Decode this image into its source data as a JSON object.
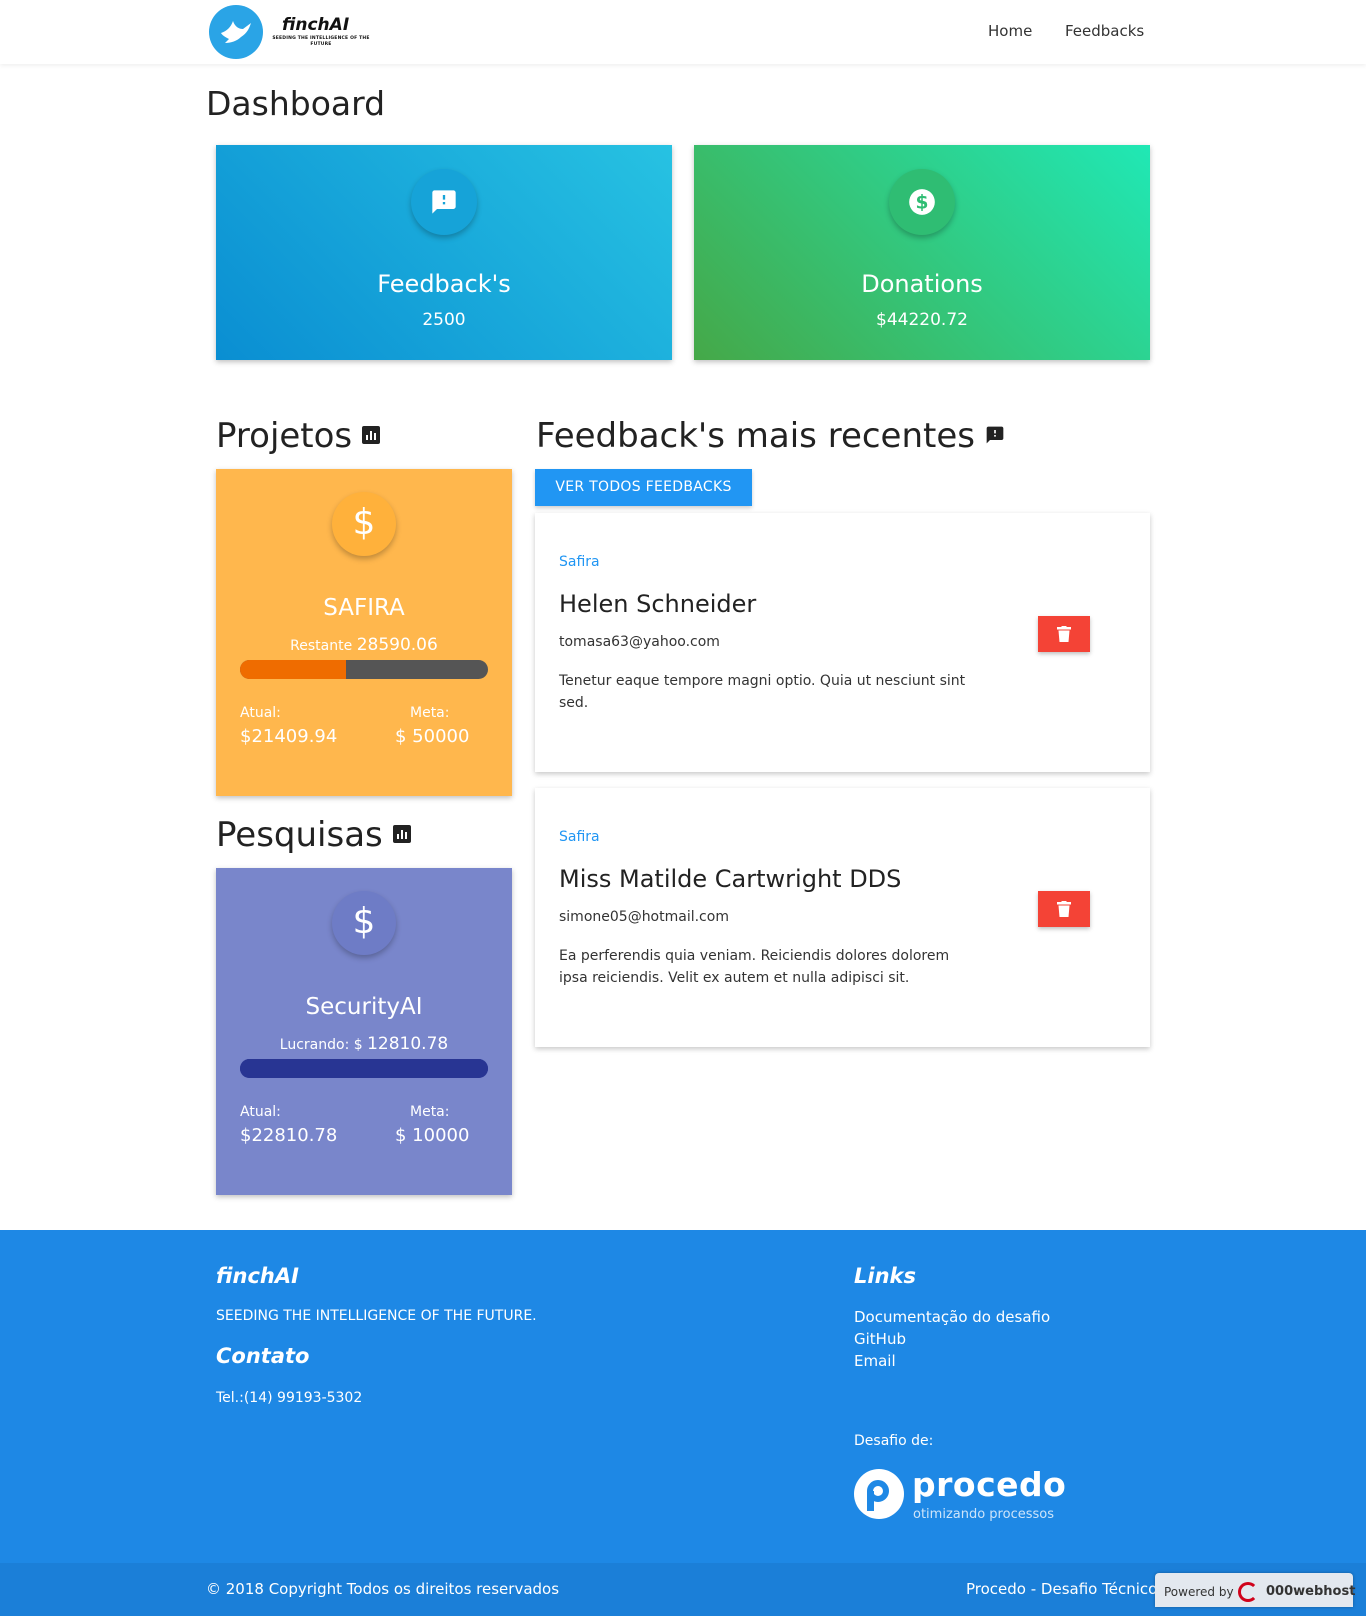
{
  "nav": {
    "brand": "finchAI",
    "tagline": "SEEDING THE INTELLIGENCE OF THE FUTURE",
    "links": [
      "Home",
      "Feedbacks"
    ]
  },
  "page_title": "Dashboard",
  "stats": {
    "feedbacks": {
      "label": "Feedback's",
      "value": "2500",
      "icon": "feedback-icon"
    },
    "donations": {
      "label": "Donations",
      "value": "$44220.72",
      "icon": "dollar-icon"
    }
  },
  "projetos": {
    "title": "Projetos",
    "card": {
      "name": "SAFIRA",
      "sub_label": "Restante",
      "sub_value": "28590.06",
      "progress": 0.428,
      "atual_label": "Atual:",
      "atual_value": "$21409.94",
      "meta_label": "Meta:",
      "meta_value": "$ 50000"
    }
  },
  "pesquisas": {
    "title": "Pesquisas",
    "card": {
      "name": "SecurityAI",
      "sub_label": "Lucrando: $",
      "sub_value": "12810.78",
      "progress": 1.0,
      "atual_label": "Atual:",
      "atual_value": "$22810.78",
      "meta_label": "Meta:",
      "meta_value": "$ 10000"
    }
  },
  "feedbacks": {
    "title": "Feedback's mais recentes",
    "button": "VER TODOS FEEDBACKS",
    "items": [
      {
        "project": "Safira",
        "name": "Helen Schneider",
        "email": "tomasa63@yahoo.com",
        "message": "Tenetur eaque tempore magni optio. Quia ut nesciunt sint sed."
      },
      {
        "project": "Safira",
        "name": "Miss Matilde Cartwright DDS",
        "email": "simone05@hotmail.com",
        "message": "Ea perferendis quia veniam. Reiciendis dolores dolorem ipsa reiciendis. Velit ex autem et nulla adipisci sit."
      }
    ]
  },
  "footer": {
    "brand": "finchAI",
    "tagline": "SEEDING THE INTELLIGENCE OF THE FUTURE.",
    "contato_title": "Contato",
    "tel": "Tel.:(14) 99193-5302",
    "links_title": "Links",
    "links": [
      "Documentação do desafio",
      "GitHub",
      "Email"
    ],
    "desafio_label": "Desafio de:",
    "partner_name": "procedo",
    "partner_sub": "otimizando processos",
    "copyright": "© 2018 Copyright Todos os direitos reservados",
    "right_text": "Procedo - Desafio Técnico",
    "powered_label": "Powered by",
    "powered_name": "000webhost"
  },
  "colors": {
    "primary": "#2196f3",
    "footer": "#1e88e5",
    "safira": "#ffb74d",
    "security": "#7986cb",
    "delete": "#f44336"
  }
}
